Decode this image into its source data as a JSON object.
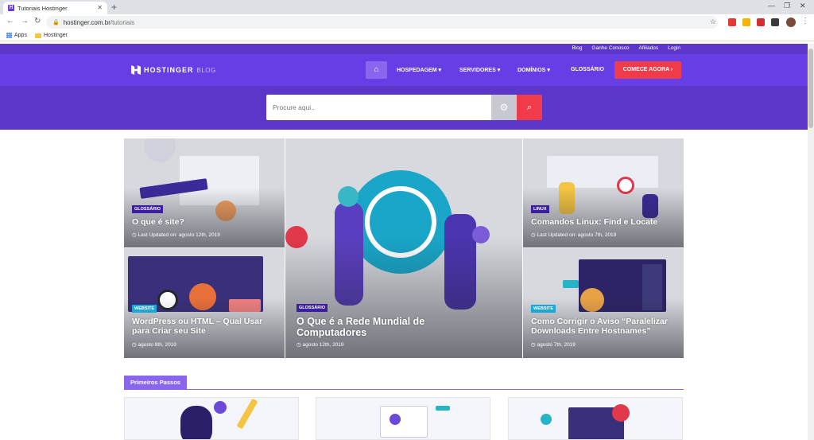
{
  "browser": {
    "tab_title": "Tutoriais Hostinger",
    "new_tab": "+",
    "url_host": "hostinger.com.br",
    "url_path": "/tutoriais",
    "bookmarks": [
      "Apps",
      "Hostinger"
    ]
  },
  "site": {
    "top_links": [
      "Blog",
      "Ganhe Conosco",
      "Afiliados",
      "Login"
    ],
    "logo_brand": "HOSTINGER",
    "logo_blog": "BLOG",
    "nav": [
      "HOSPEDAGEM ▾",
      "SERVIDORES ▾",
      "DOMÍNIOS ▾",
      "GLOSSÁRIO"
    ],
    "cta": "COMECE AGORA ›",
    "search": {
      "placeholder": "Procure aqui.."
    },
    "colors": {
      "primary": "#673de6",
      "dark": "#5b36c8",
      "accent": "#f03c4a",
      "badge_purple": "#3b1fa0",
      "badge_cyan": "#1ba8d6"
    }
  },
  "cards": [
    {
      "badge": "GLOSSÁRIO",
      "title": "O que é site?",
      "meta": "Last Updated on: agosto 12th, 2019"
    },
    {
      "badge": "LINUX",
      "title": "Comandos Linux: Find e Locate",
      "meta": "Last Updated on: agosto 7th, 2019"
    },
    {
      "badge": "WEBSITE",
      "title": "WordPress ou HTML – Qual Usar para Criar seu Site",
      "meta": "agosto 8th, 2019"
    },
    {
      "badge": "GLOSSÁRIO",
      "title": "O Que é a Rede Mundial de Computadores",
      "meta": "agosto 12th, 2019"
    },
    {
      "badge": "WEBSITE",
      "title": "Como Corrigir o Aviso “Paralelizar Downloads Entre Hostnames”",
      "meta": "agosto 7th, 2019"
    }
  ],
  "section": {
    "title": "Primeiros Passos"
  }
}
